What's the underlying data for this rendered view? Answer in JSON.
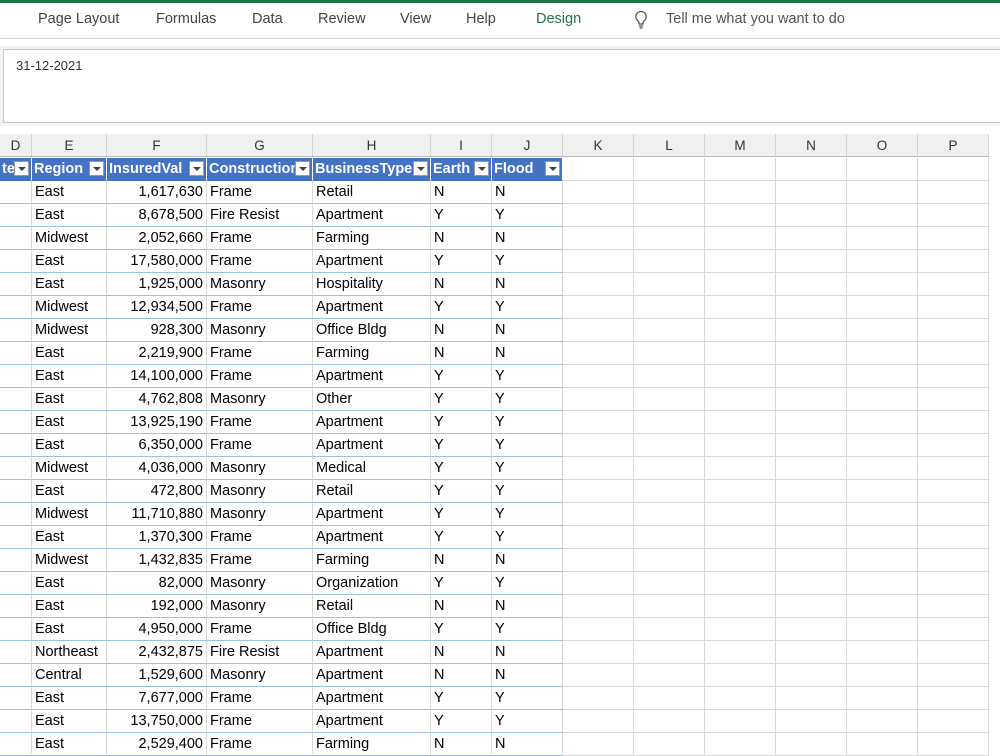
{
  "ribbon": {
    "tabs": [
      "Page Layout",
      "Formulas",
      "Data",
      "Review",
      "View",
      "Help",
      "Design"
    ],
    "active_tab": "Design",
    "tell_me": "Tell me what you want to do",
    "accent": "#217346"
  },
  "formula_bar": {
    "value": "31-12-2021"
  },
  "sheet": {
    "column_letters": [
      "D",
      "E",
      "F",
      "G",
      "H",
      "I",
      "J",
      "K",
      "L",
      "M",
      "N",
      "O",
      "P"
    ],
    "table_headers": [
      "te",
      "Region",
      "InsuredVal",
      "Construction",
      "BusinessType",
      "Earth",
      "Flood"
    ],
    "header_color": "#4472c4",
    "rows": [
      [
        "East",
        "1,617,630",
        "Frame",
        "Retail",
        "N",
        "N"
      ],
      [
        "East",
        "8,678,500",
        "Fire Resist",
        "Apartment",
        "Y",
        "Y"
      ],
      [
        "Midwest",
        "2,052,660",
        "Frame",
        "Farming",
        "N",
        "N"
      ],
      [
        "East",
        "17,580,000",
        "Frame",
        "Apartment",
        "Y",
        "Y"
      ],
      [
        "East",
        "1,925,000",
        "Masonry",
        "Hospitality",
        "N",
        "N"
      ],
      [
        "Midwest",
        "12,934,500",
        "Frame",
        "Apartment",
        "Y",
        "Y"
      ],
      [
        "Midwest",
        "928,300",
        "Masonry",
        "Office Bldg",
        "N",
        "N"
      ],
      [
        "East",
        "2,219,900",
        "Frame",
        "Farming",
        "N",
        "N"
      ],
      [
        "East",
        "14,100,000",
        "Frame",
        "Apartment",
        "Y",
        "Y"
      ],
      [
        "East",
        "4,762,808",
        "Masonry",
        "Other",
        "Y",
        "Y"
      ],
      [
        "East",
        "13,925,190",
        "Frame",
        "Apartment",
        "Y",
        "Y"
      ],
      [
        "East",
        "6,350,000",
        "Frame",
        "Apartment",
        "Y",
        "Y"
      ],
      [
        "Midwest",
        "4,036,000",
        "Masonry",
        "Medical",
        "Y",
        "Y"
      ],
      [
        "East",
        "472,800",
        "Masonry",
        "Retail",
        "Y",
        "Y"
      ],
      [
        "Midwest",
        "11,710,880",
        "Masonry",
        "Apartment",
        "Y",
        "Y"
      ],
      [
        "East",
        "1,370,300",
        "Frame",
        "Apartment",
        "Y",
        "Y"
      ],
      [
        "Midwest",
        "1,432,835",
        "Frame",
        "Farming",
        "N",
        "N"
      ],
      [
        "East",
        "82,000",
        "Masonry",
        "Organization",
        "Y",
        "Y"
      ],
      [
        "East",
        "192,000",
        "Masonry",
        "Retail",
        "N",
        "N"
      ],
      [
        "East",
        "4,950,000",
        "Frame",
        "Office Bldg",
        "Y",
        "Y"
      ],
      [
        "Northeast",
        "2,432,875",
        "Fire Resist",
        "Apartment",
        "N",
        "N"
      ],
      [
        "Central",
        "1,529,600",
        "Masonry",
        "Apartment",
        "N",
        "N"
      ],
      [
        "East",
        "7,677,000",
        "Frame",
        "Apartment",
        "Y",
        "Y"
      ],
      [
        "East",
        "13,750,000",
        "Frame",
        "Apartment",
        "Y",
        "Y"
      ],
      [
        "East",
        "2,529,400",
        "Frame",
        "Farming",
        "N",
        "N"
      ]
    ]
  }
}
